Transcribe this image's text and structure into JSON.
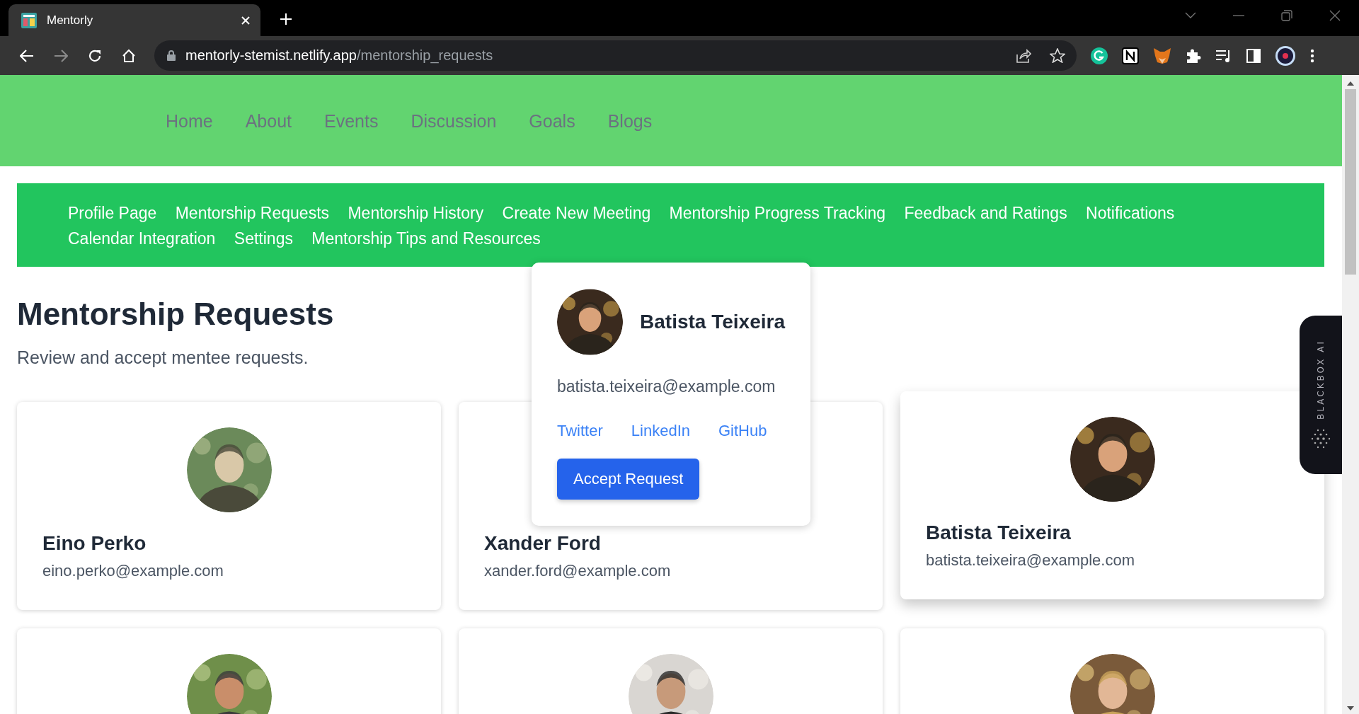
{
  "browser": {
    "tab": {
      "title": "Mentorly"
    },
    "url": {
      "host": "mentorly-stemist.netlify.app",
      "path": "/mentorship_requests"
    }
  },
  "site_nav": [
    {
      "label": "Home"
    },
    {
      "label": "About"
    },
    {
      "label": "Events"
    },
    {
      "label": "Discussion"
    },
    {
      "label": "Goals"
    },
    {
      "label": "Blogs"
    }
  ],
  "sub_nav": [
    {
      "label": "Profile Page"
    },
    {
      "label": "Mentorship Requests"
    },
    {
      "label": "Mentorship History"
    },
    {
      "label": "Create New Meeting"
    },
    {
      "label": "Mentorship Progress Tracking"
    },
    {
      "label": "Feedback and Ratings"
    },
    {
      "label": "Notifications"
    },
    {
      "label": "Calendar Integration"
    },
    {
      "label": "Settings"
    },
    {
      "label": "Mentorship Tips and Resources"
    }
  ],
  "page": {
    "title": "Mentorship Requests",
    "subtitle": "Review and accept mentee requests."
  },
  "cards": [
    {
      "name": "Eino Perko",
      "email": "eino.perko@example.com",
      "hovered": false
    },
    {
      "name": "Xander Ford",
      "email": "xander.ford@example.com",
      "hovered": false
    },
    {
      "name": "Batista Teixeira",
      "email": "batista.teixeira@example.com",
      "hovered": true
    },
    {
      "hovered": false
    },
    {
      "hovered": false
    },
    {
      "hovered": false
    }
  ],
  "popup": {
    "name": "Batista Teixeira",
    "email": "batista.teixeira@example.com",
    "links": [
      {
        "label": "Twitter"
      },
      {
        "label": "LinkedIn"
      },
      {
        "label": "GitHub"
      }
    ],
    "button": "Accept Request"
  },
  "widget": {
    "label": "BLACKBOX AI"
  }
}
